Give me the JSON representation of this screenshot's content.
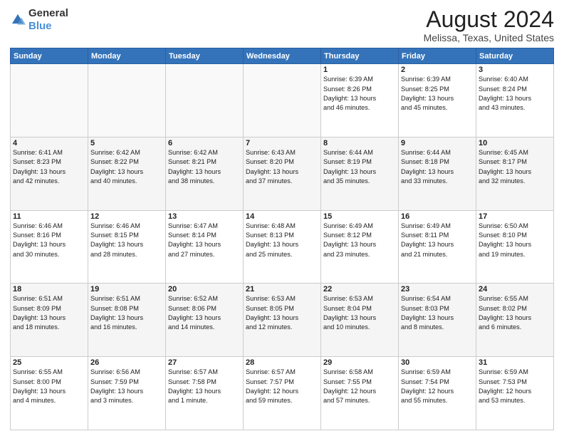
{
  "header": {
    "logo_general": "General",
    "logo_blue": "Blue",
    "month_year": "August 2024",
    "location": "Melissa, Texas, United States"
  },
  "weekdays": [
    "Sunday",
    "Monday",
    "Tuesday",
    "Wednesday",
    "Thursday",
    "Friday",
    "Saturday"
  ],
  "weeks": [
    [
      {
        "day": "",
        "info": ""
      },
      {
        "day": "",
        "info": ""
      },
      {
        "day": "",
        "info": ""
      },
      {
        "day": "",
        "info": ""
      },
      {
        "day": "1",
        "info": "Sunrise: 6:39 AM\nSunset: 8:26 PM\nDaylight: 13 hours\nand 46 minutes."
      },
      {
        "day": "2",
        "info": "Sunrise: 6:39 AM\nSunset: 8:25 PM\nDaylight: 13 hours\nand 45 minutes."
      },
      {
        "day": "3",
        "info": "Sunrise: 6:40 AM\nSunset: 8:24 PM\nDaylight: 13 hours\nand 43 minutes."
      }
    ],
    [
      {
        "day": "4",
        "info": "Sunrise: 6:41 AM\nSunset: 8:23 PM\nDaylight: 13 hours\nand 42 minutes."
      },
      {
        "day": "5",
        "info": "Sunrise: 6:42 AM\nSunset: 8:22 PM\nDaylight: 13 hours\nand 40 minutes."
      },
      {
        "day": "6",
        "info": "Sunrise: 6:42 AM\nSunset: 8:21 PM\nDaylight: 13 hours\nand 38 minutes."
      },
      {
        "day": "7",
        "info": "Sunrise: 6:43 AM\nSunset: 8:20 PM\nDaylight: 13 hours\nand 37 minutes."
      },
      {
        "day": "8",
        "info": "Sunrise: 6:44 AM\nSunset: 8:19 PM\nDaylight: 13 hours\nand 35 minutes."
      },
      {
        "day": "9",
        "info": "Sunrise: 6:44 AM\nSunset: 8:18 PM\nDaylight: 13 hours\nand 33 minutes."
      },
      {
        "day": "10",
        "info": "Sunrise: 6:45 AM\nSunset: 8:17 PM\nDaylight: 13 hours\nand 32 minutes."
      }
    ],
    [
      {
        "day": "11",
        "info": "Sunrise: 6:46 AM\nSunset: 8:16 PM\nDaylight: 13 hours\nand 30 minutes."
      },
      {
        "day": "12",
        "info": "Sunrise: 6:46 AM\nSunset: 8:15 PM\nDaylight: 13 hours\nand 28 minutes."
      },
      {
        "day": "13",
        "info": "Sunrise: 6:47 AM\nSunset: 8:14 PM\nDaylight: 13 hours\nand 27 minutes."
      },
      {
        "day": "14",
        "info": "Sunrise: 6:48 AM\nSunset: 8:13 PM\nDaylight: 13 hours\nand 25 minutes."
      },
      {
        "day": "15",
        "info": "Sunrise: 6:49 AM\nSunset: 8:12 PM\nDaylight: 13 hours\nand 23 minutes."
      },
      {
        "day": "16",
        "info": "Sunrise: 6:49 AM\nSunset: 8:11 PM\nDaylight: 13 hours\nand 21 minutes."
      },
      {
        "day": "17",
        "info": "Sunrise: 6:50 AM\nSunset: 8:10 PM\nDaylight: 13 hours\nand 19 minutes."
      }
    ],
    [
      {
        "day": "18",
        "info": "Sunrise: 6:51 AM\nSunset: 8:09 PM\nDaylight: 13 hours\nand 18 minutes."
      },
      {
        "day": "19",
        "info": "Sunrise: 6:51 AM\nSunset: 8:08 PM\nDaylight: 13 hours\nand 16 minutes."
      },
      {
        "day": "20",
        "info": "Sunrise: 6:52 AM\nSunset: 8:06 PM\nDaylight: 13 hours\nand 14 minutes."
      },
      {
        "day": "21",
        "info": "Sunrise: 6:53 AM\nSunset: 8:05 PM\nDaylight: 13 hours\nand 12 minutes."
      },
      {
        "day": "22",
        "info": "Sunrise: 6:53 AM\nSunset: 8:04 PM\nDaylight: 13 hours\nand 10 minutes."
      },
      {
        "day": "23",
        "info": "Sunrise: 6:54 AM\nSunset: 8:03 PM\nDaylight: 13 hours\nand 8 minutes."
      },
      {
        "day": "24",
        "info": "Sunrise: 6:55 AM\nSunset: 8:02 PM\nDaylight: 13 hours\nand 6 minutes."
      }
    ],
    [
      {
        "day": "25",
        "info": "Sunrise: 6:55 AM\nSunset: 8:00 PM\nDaylight: 13 hours\nand 4 minutes."
      },
      {
        "day": "26",
        "info": "Sunrise: 6:56 AM\nSunset: 7:59 PM\nDaylight: 13 hours\nand 3 minutes."
      },
      {
        "day": "27",
        "info": "Sunrise: 6:57 AM\nSunset: 7:58 PM\nDaylight: 13 hours\nand 1 minute."
      },
      {
        "day": "28",
        "info": "Sunrise: 6:57 AM\nSunset: 7:57 PM\nDaylight: 12 hours\nand 59 minutes."
      },
      {
        "day": "29",
        "info": "Sunrise: 6:58 AM\nSunset: 7:55 PM\nDaylight: 12 hours\nand 57 minutes."
      },
      {
        "day": "30",
        "info": "Sunrise: 6:59 AM\nSunset: 7:54 PM\nDaylight: 12 hours\nand 55 minutes."
      },
      {
        "day": "31",
        "info": "Sunrise: 6:59 AM\nSunset: 7:53 PM\nDaylight: 12 hours\nand 53 minutes."
      }
    ]
  ]
}
